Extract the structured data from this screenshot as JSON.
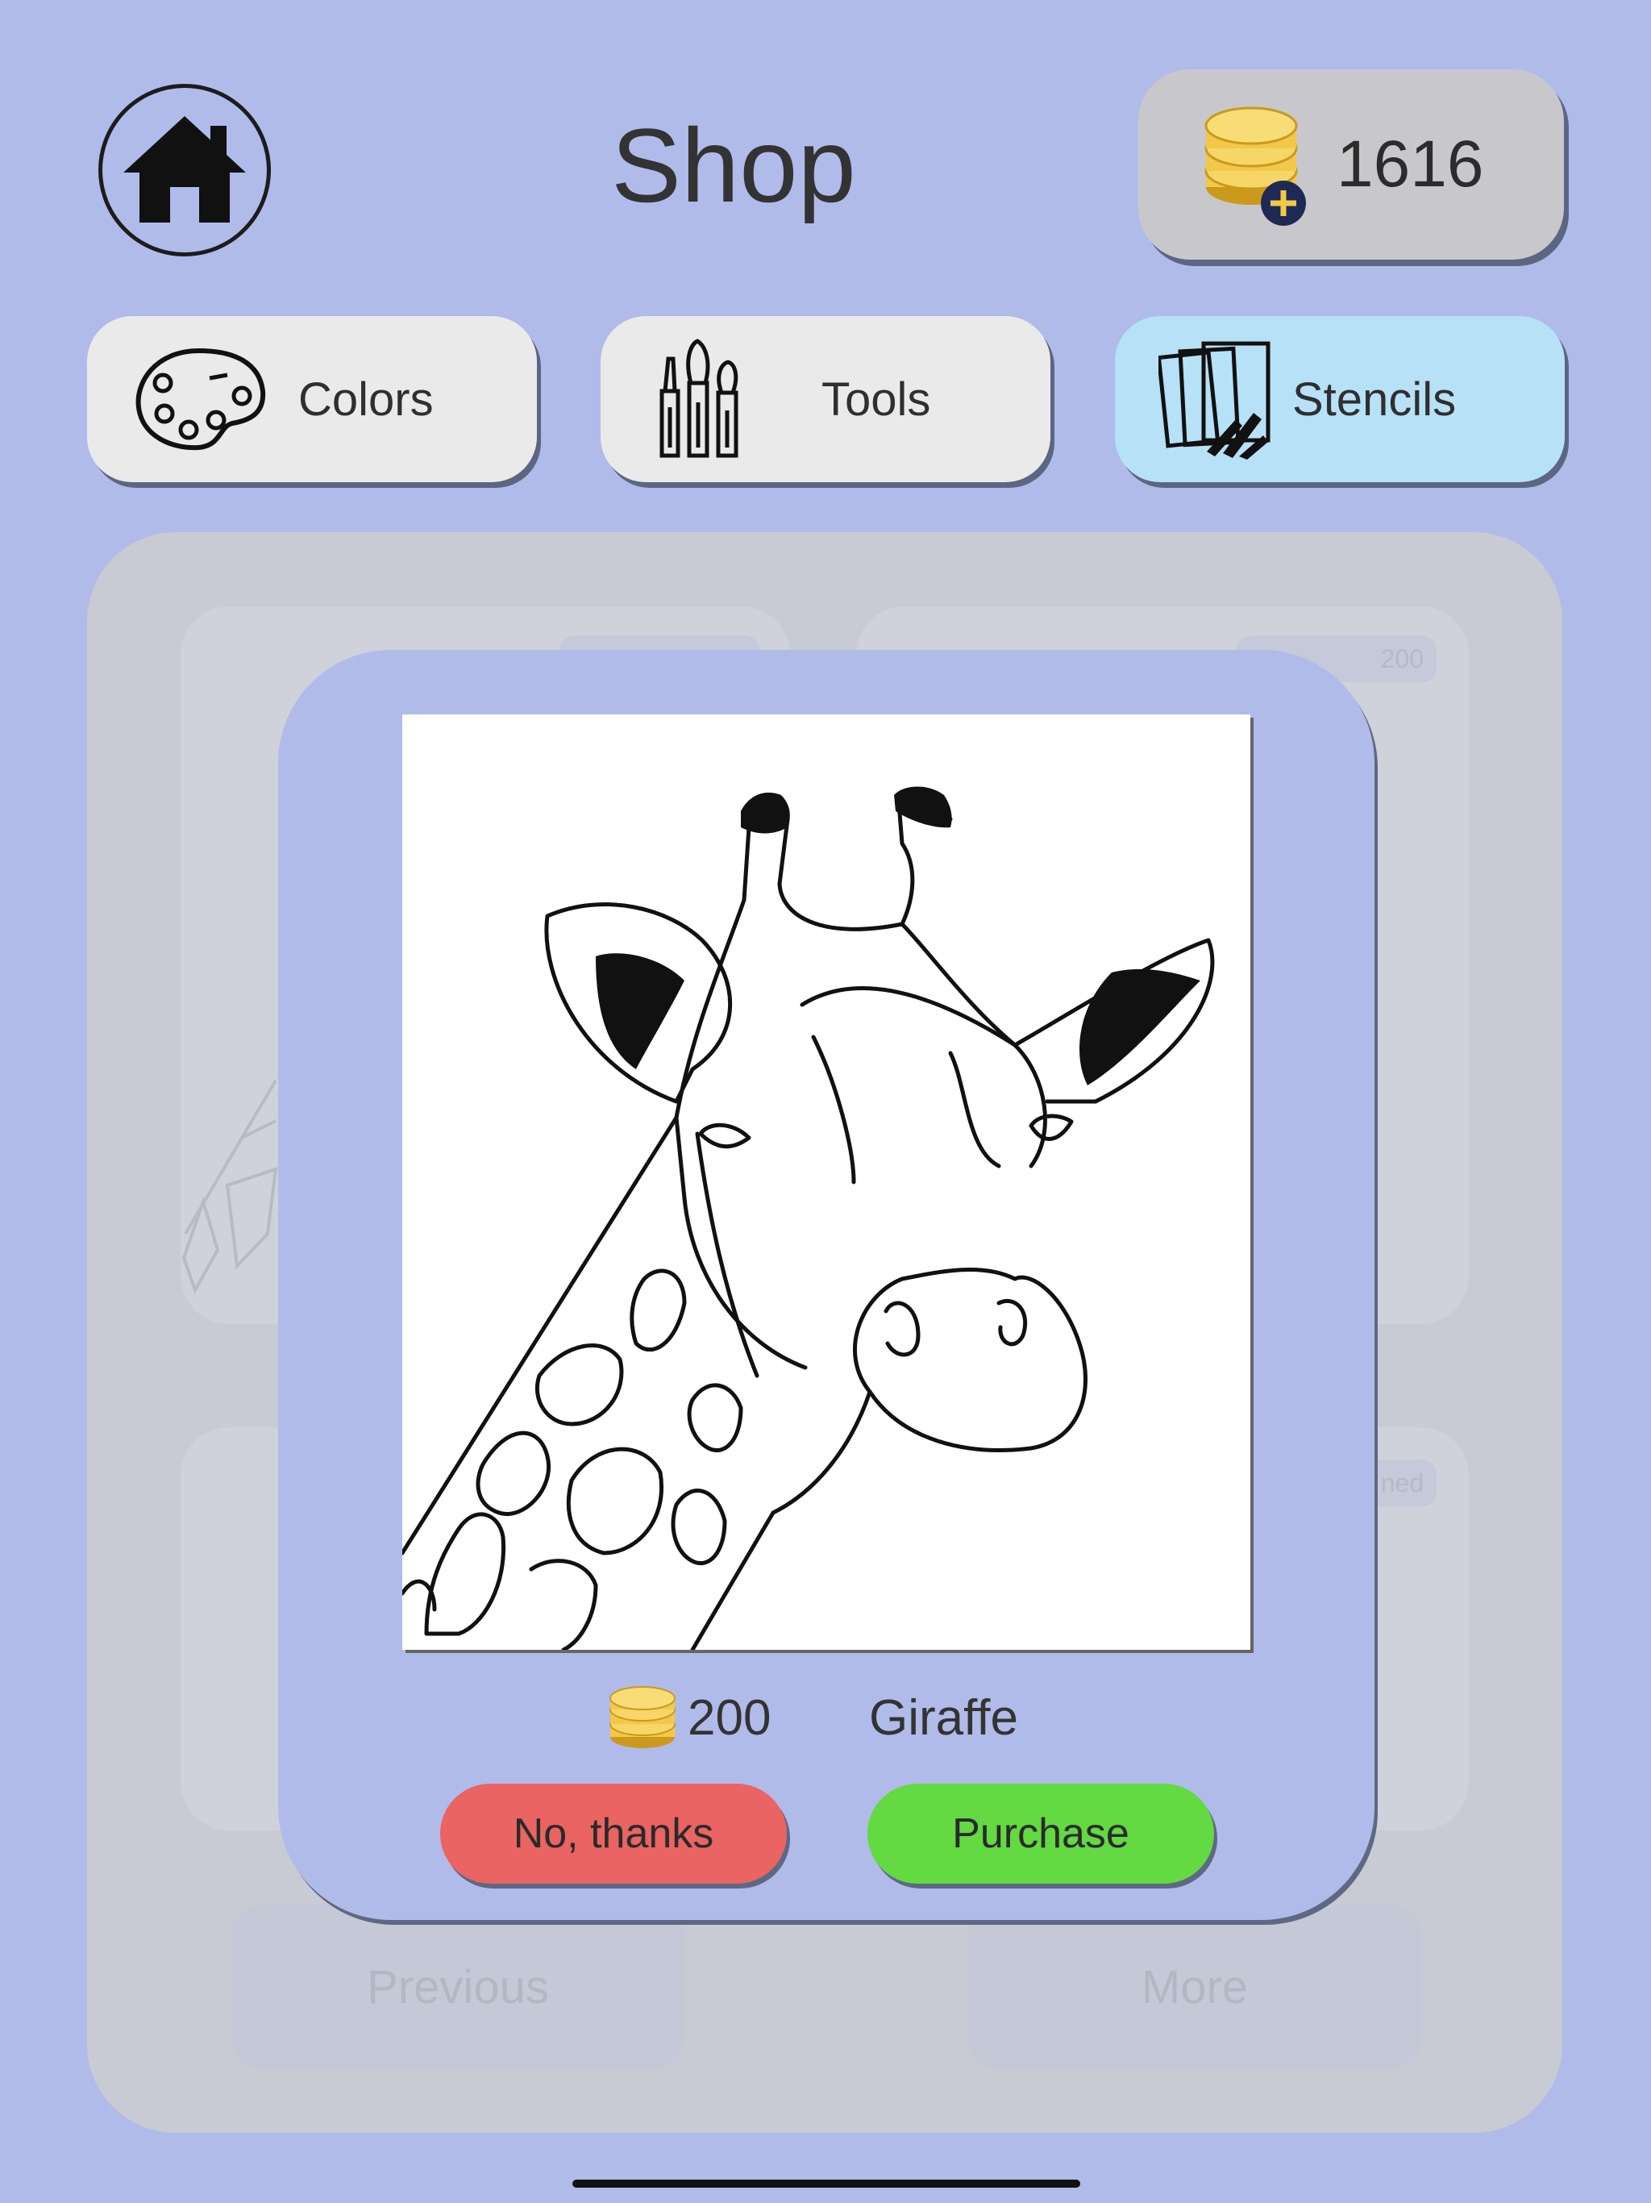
{
  "header": {
    "title": "Shop",
    "coins": "1616"
  },
  "tabs": [
    {
      "label": "Colors",
      "icon": "palette-icon",
      "selected": false
    },
    {
      "label": "Tools",
      "icon": "brushes-icon",
      "selected": false
    },
    {
      "label": "Stencils",
      "icon": "stencils-icon",
      "selected": true
    }
  ],
  "background": {
    "card_prices": [
      "200",
      "ned"
    ],
    "nav": {
      "previous": "Previous",
      "more": "More"
    }
  },
  "modal": {
    "item_name": "Giraffe",
    "price": "200",
    "decline_label": "No, thanks",
    "purchase_label": "Purchase"
  },
  "colors": {
    "background": "#b0bbea",
    "selected_tab": "#b7e1f6",
    "decline": "#e96462",
    "purchase": "#63d942",
    "coin_gold": "#f2c84b"
  }
}
